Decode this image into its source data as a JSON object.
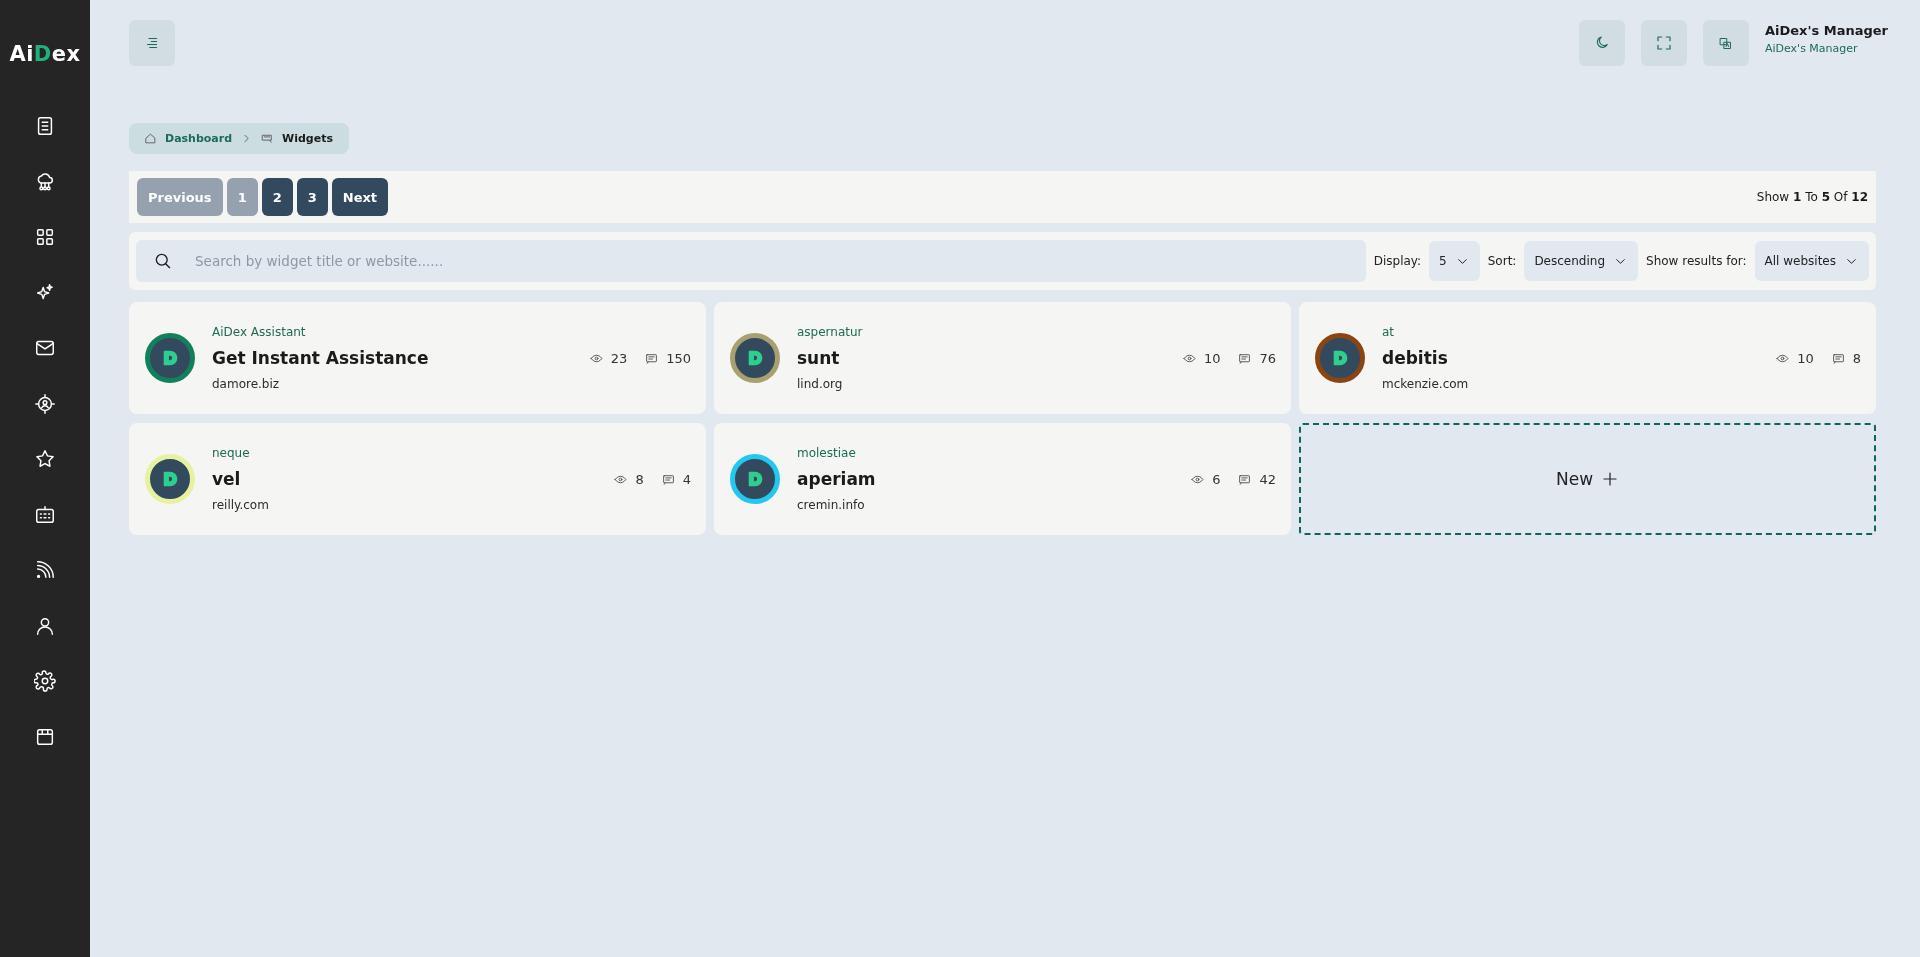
{
  "sidebar": {
    "logo": {
      "prefix": "Ai",
      "mark": "D",
      "suffix": "ex"
    }
  },
  "header": {
    "user_name": "AiDex's Manager",
    "user_role": "AiDex's Manager"
  },
  "breadcrumb": [
    {
      "label": "Dashboard",
      "current": false
    },
    {
      "label": "Widgets",
      "current": true
    }
  ],
  "pagination": {
    "previous": {
      "label": "Previous",
      "disabled": true
    },
    "pages": [
      {
        "label": "1",
        "selected": true
      },
      {
        "label": "2",
        "selected": false
      },
      {
        "label": "3",
        "selected": false
      }
    ],
    "next": {
      "label": "Next",
      "disabled": false
    },
    "summary": "Show **1** To **5** Of **12**"
  },
  "filters": {
    "search": {
      "placeholder": "Search by widget title or website......"
    },
    "display": {
      "label": "Display:",
      "value": "5"
    },
    "sort": {
      "label": "Sort:",
      "value": "Descending"
    },
    "results_for": {
      "label": "Show results for:",
      "value": "All websites"
    }
  },
  "widgets": [
    {
      "category": "AiDex Assistant",
      "title": "Get Instant Assistance",
      "website": "damore.biz",
      "views": "23",
      "comments": "150",
      "color": "#12805c"
    },
    {
      "category": "aspernatur",
      "title": "sunt",
      "website": "lind.org",
      "views": "10",
      "comments": "76",
      "color": "#a8a070"
    },
    {
      "category": "at",
      "title": "debitis",
      "website": "mckenzie.com",
      "views": "10",
      "comments": "8",
      "color": "#8b4513"
    },
    {
      "category": "neque",
      "title": "vel",
      "website": "reilly.com",
      "views": "8",
      "comments": "4",
      "color": "#e6f2a0"
    },
    {
      "category": "molestiae",
      "title": "aperiam",
      "website": "cremin.info",
      "views": "6",
      "comments": "42",
      "color": "#22c8ee"
    }
  ],
  "new_widget": {
    "label": "New"
  }
}
